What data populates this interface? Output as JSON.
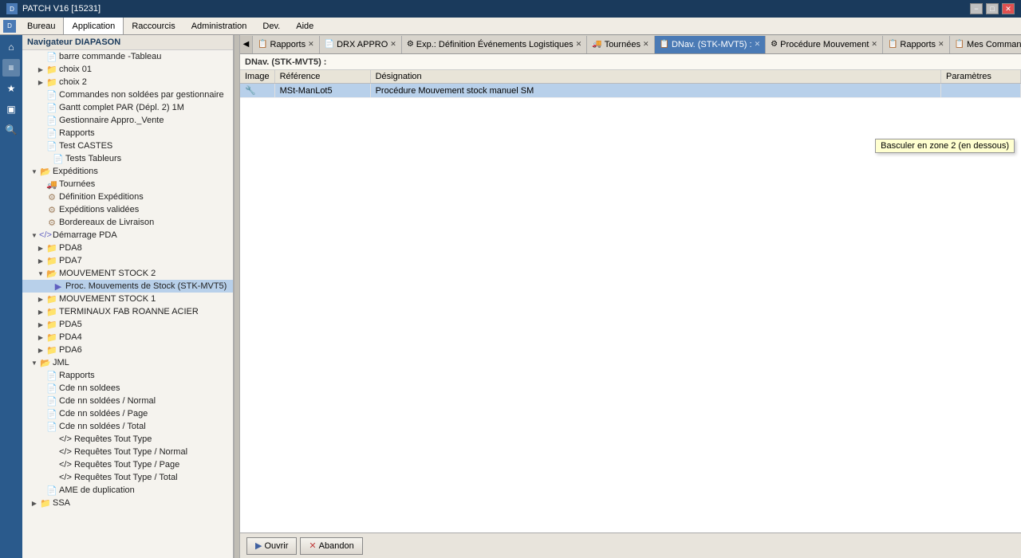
{
  "titlebar": {
    "title": "PATCH V16 [15231]",
    "min_label": "−",
    "max_label": "□",
    "close_label": "✕"
  },
  "menubar": {
    "items": [
      {
        "id": "bureau",
        "label": "Bureau"
      },
      {
        "id": "application",
        "label": "Application",
        "active": true
      },
      {
        "id": "raccourcis",
        "label": "Raccourcis"
      },
      {
        "id": "administration",
        "label": "Administration"
      },
      {
        "id": "dev",
        "label": "Dev."
      },
      {
        "id": "aide",
        "label": "Aide"
      }
    ]
  },
  "sidebar_icons": [
    {
      "id": "home",
      "icon": "⌂",
      "active": false
    },
    {
      "id": "star",
      "icon": "★",
      "active": false
    },
    {
      "id": "monitor",
      "icon": "▣",
      "active": false
    },
    {
      "id": "search",
      "icon": "🔍",
      "active": false
    }
  ],
  "nav": {
    "header": "Navigateur DIAPASON",
    "items": [
      {
        "id": "barre-commande",
        "label": "barre commande -Tableau",
        "indent": "indent2",
        "icon": "file",
        "expand": false
      },
      {
        "id": "choix01",
        "label": "choix 01",
        "indent": "indent2",
        "icon": "folder",
        "expand": true
      },
      {
        "id": "choix2",
        "label": "choix 2",
        "indent": "indent2",
        "icon": "folder",
        "expand": false
      },
      {
        "id": "cmd-non-soldees",
        "label": "Commandes non soldées par gestionnaire",
        "indent": "indent2",
        "icon": "file"
      },
      {
        "id": "gantt",
        "label": "Gantt complet PAR (Dépl. 2) 1M",
        "indent": "indent2",
        "icon": "file"
      },
      {
        "id": "gestionnaire",
        "label": "Gestionnaire Appro._Vente",
        "indent": "indent2",
        "icon": "file"
      },
      {
        "id": "rapports1",
        "label": "Rapports",
        "indent": "indent2",
        "icon": "file"
      },
      {
        "id": "test-castes",
        "label": "Test CASTES",
        "indent": "indent2",
        "icon": "file"
      },
      {
        "id": "tests-tableurs",
        "label": "Tests Tableurs",
        "indent": "indent3",
        "icon": "file"
      },
      {
        "id": "expeditions",
        "label": "Expéditions",
        "indent": "indent1",
        "icon": "folder",
        "expand": true,
        "expanded": true
      },
      {
        "id": "tournees",
        "label": "Tournées",
        "indent": "indent2",
        "icon": "truck"
      },
      {
        "id": "def-expeditions",
        "label": "Définition Expéditions",
        "indent": "indent2",
        "icon": "truck"
      },
      {
        "id": "exp-validees",
        "label": "Expéditions validées",
        "indent": "indent2",
        "icon": "truck"
      },
      {
        "id": "bordereaoux",
        "label": "Bordereaux de Livraison",
        "indent": "indent2",
        "icon": "truck"
      },
      {
        "id": "demarrage-pda",
        "label": "Démarrage PDA",
        "indent": "indent1",
        "icon": "code",
        "expand": true,
        "expanded": true
      },
      {
        "id": "pda8",
        "label": "PDA8",
        "indent": "indent2",
        "icon": "folder",
        "expand": true
      },
      {
        "id": "pda7",
        "label": "PDA7",
        "indent": "indent2",
        "icon": "folder",
        "expand": true
      },
      {
        "id": "mvt-stock2",
        "label": "MOUVEMENT STOCK 2",
        "indent": "indent2",
        "icon": "folder",
        "expand": true,
        "expanded": true
      },
      {
        "id": "proc-mvt",
        "label": "Proc. Mouvements de Stock (STK-MVT5)",
        "indent": "indent3",
        "icon": "file-special"
      },
      {
        "id": "mvt-stock1",
        "label": "MOUVEMENT STOCK 1",
        "indent": "indent2",
        "icon": "folder",
        "expand": true
      },
      {
        "id": "terminaux",
        "label": "TERMINAUX FAB ROANNE ACIER",
        "indent": "indent2",
        "icon": "folder",
        "expand": true
      },
      {
        "id": "pda5",
        "label": "PDA5",
        "indent": "indent2",
        "icon": "folder",
        "expand": true
      },
      {
        "id": "pda4",
        "label": "PDA4",
        "indent": "indent2",
        "icon": "folder",
        "expand": true
      },
      {
        "id": "pda6",
        "label": "PDA6",
        "indent": "indent2",
        "icon": "folder",
        "expand": true
      },
      {
        "id": "jml",
        "label": "JML",
        "indent": "indent1",
        "icon": "folder",
        "expand": true,
        "expanded": true
      },
      {
        "id": "rapports2",
        "label": "Rapports",
        "indent": "indent2",
        "icon": "file"
      },
      {
        "id": "cde-nn-soldees",
        "label": "Cde nn soldees",
        "indent": "indent2",
        "icon": "file"
      },
      {
        "id": "cde-nn-soldees-normal",
        "label": "Cde nn soldées / Normal",
        "indent": "indent2",
        "icon": "file"
      },
      {
        "id": "cde-nn-soldees-page",
        "label": "Cde nn soldées / Page",
        "indent": "indent2",
        "icon": "file"
      },
      {
        "id": "cde-nn-soldees-total",
        "label": "Cde nn soldées / Total",
        "indent": "indent2",
        "icon": "file"
      },
      {
        "id": "req-tout-type",
        "label": "</> Requêtes Tout Type",
        "indent": "indent2",
        "icon": "none"
      },
      {
        "id": "req-tout-type-normal",
        "label": "</> Requêtes Tout Type / Normal",
        "indent": "indent2",
        "icon": "none"
      },
      {
        "id": "req-tout-type-page",
        "label": "</> Requêtes Tout Type / Page",
        "indent": "indent2",
        "icon": "none"
      },
      {
        "id": "req-tout-type-total",
        "label": "</> Requêtes Tout Type / Total",
        "indent": "indent2",
        "icon": "none"
      },
      {
        "id": "ame-duplication",
        "label": "AME de duplication",
        "indent": "indent2",
        "icon": "file"
      },
      {
        "id": "ssa",
        "label": "SSA",
        "indent": "indent1",
        "icon": "folder",
        "expand": true
      }
    ]
  },
  "tabs": [
    {
      "id": "rapports",
      "label": "Rapports",
      "icon": "📋",
      "active": false,
      "closeable": true
    },
    {
      "id": "drx-appro",
      "label": "DRX APPRO",
      "icon": "📄",
      "active": false,
      "closeable": true
    },
    {
      "id": "exp-def",
      "label": "Exp.: Définition Événements Logistiques",
      "icon": "⚙",
      "active": false,
      "closeable": true
    },
    {
      "id": "tournees",
      "label": "Tournées",
      "icon": "🚚",
      "active": false,
      "closeable": true
    },
    {
      "id": "dnav-stk",
      "label": "DNav. (STK-MVT5) :",
      "icon": "📋",
      "active": true,
      "closeable": true
    },
    {
      "id": "proc-mouvement",
      "label": "Procédure Mouvement",
      "icon": "⚙",
      "active": false,
      "closeable": true
    },
    {
      "id": "rapports2",
      "label": "Rapports",
      "icon": "📋",
      "active": false,
      "closeable": true
    },
    {
      "id": "mes-commandes",
      "label": "Mes Commandes Non Soldées",
      "icon": "📋",
      "active": false,
      "closeable": true
    }
  ],
  "content": {
    "title": "DNav. (STK-MVT5) :",
    "columns": [
      {
        "id": "image",
        "label": "Image"
      },
      {
        "id": "reference",
        "label": "Référence"
      },
      {
        "id": "designation",
        "label": "Désignation"
      },
      {
        "id": "parametres",
        "label": "Paramètres"
      }
    ],
    "rows": [
      {
        "image": "🔧",
        "reference": "MSt-ManLot5",
        "designation": "Procédure Mouvement stock manuel SM",
        "parametres": ""
      }
    ]
  },
  "tooltip": {
    "text": "Basculer en zone 2 (en dessous)"
  },
  "toolbar": {
    "ouvrir_label": "Ouvrir",
    "abandon_label": "Abandon"
  }
}
